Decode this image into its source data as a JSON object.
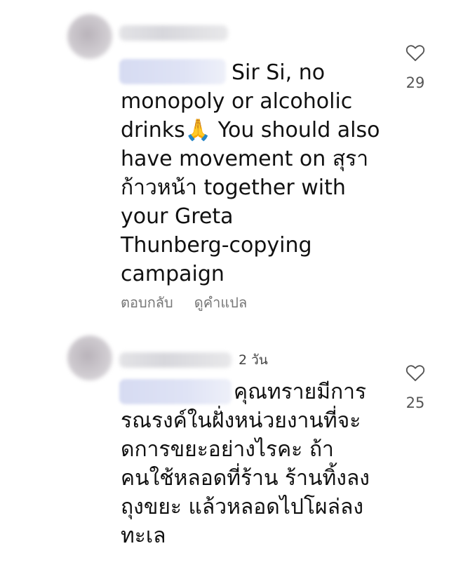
{
  "comments": [
    {
      "time_label": "",
      "text_first": "Sir Si, no",
      "text_body": "monopoly or alcoholic\ndrinks🙏 You should also\nhave movement on สุรา\nก้าวหน้า together with\nyour Greta\nThunberg-copying\ncampaign",
      "like_count": "29",
      "reply_label": "ตอบกลับ",
      "translate_label": "ดูคำแปล"
    },
    {
      "time_label": "2 วัน",
      "text_first": "คุณทรายมีการ",
      "text_body": "รณรงค์ในฝั่งหน่วยงานที่จะ\nดการขยะอย่างไรคะ ถ้า\nคนใช้หลอดที่ร้าน ร้านทิ้งลง\nถุงขยะ แล้วหลอดไปโผล่ลง\nทะเล",
      "like_count": "25"
    }
  ],
  "colors": {
    "text": "#111111",
    "muted": "#777777",
    "like": "#555555"
  }
}
